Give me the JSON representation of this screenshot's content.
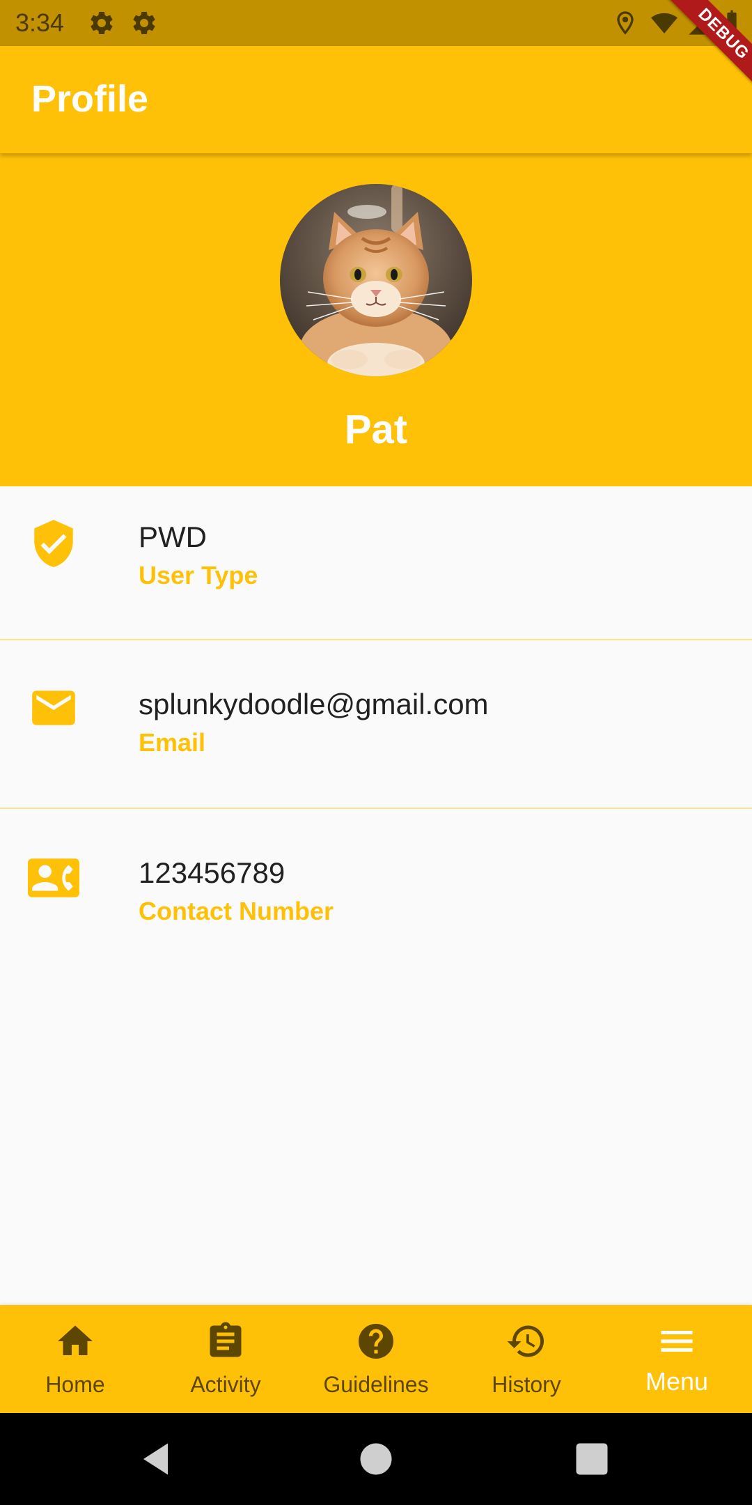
{
  "status_bar": {
    "time": "3:34",
    "icons": [
      "settings-icon",
      "settings-icon",
      "location-icon",
      "wifi-icon",
      "signal-icon",
      "battery-icon"
    ]
  },
  "debug_banner": "DEBUG",
  "app_bar": {
    "title": "Profile"
  },
  "profile": {
    "name": "Pat",
    "avatar": "cat-avatar"
  },
  "info_items": [
    {
      "icon": "verified-shield-icon",
      "value": "PWD",
      "label": "User Type"
    },
    {
      "icon": "email-icon",
      "value": "splunkydoodle@gmail.com",
      "label": "Email"
    },
    {
      "icon": "contact-phone-icon",
      "value": "123456789",
      "label": "Contact Number"
    }
  ],
  "bottom_nav": {
    "items": [
      {
        "icon": "home-icon",
        "label": "Home"
      },
      {
        "icon": "assignment-icon",
        "label": "Activity"
      },
      {
        "icon": "help-icon",
        "label": "Guidelines"
      },
      {
        "icon": "history-icon",
        "label": "History"
      },
      {
        "icon": "menu-icon",
        "label": "Menu",
        "active": true
      }
    ]
  },
  "system_nav": [
    "back-icon",
    "home-circle-icon",
    "recents-icon"
  ],
  "colors": {
    "primary": "#ffc107",
    "status_bar": "#c29100",
    "nav_inactive": "#5c4600",
    "text_primary": "#212121",
    "background": "#fafafa"
  }
}
